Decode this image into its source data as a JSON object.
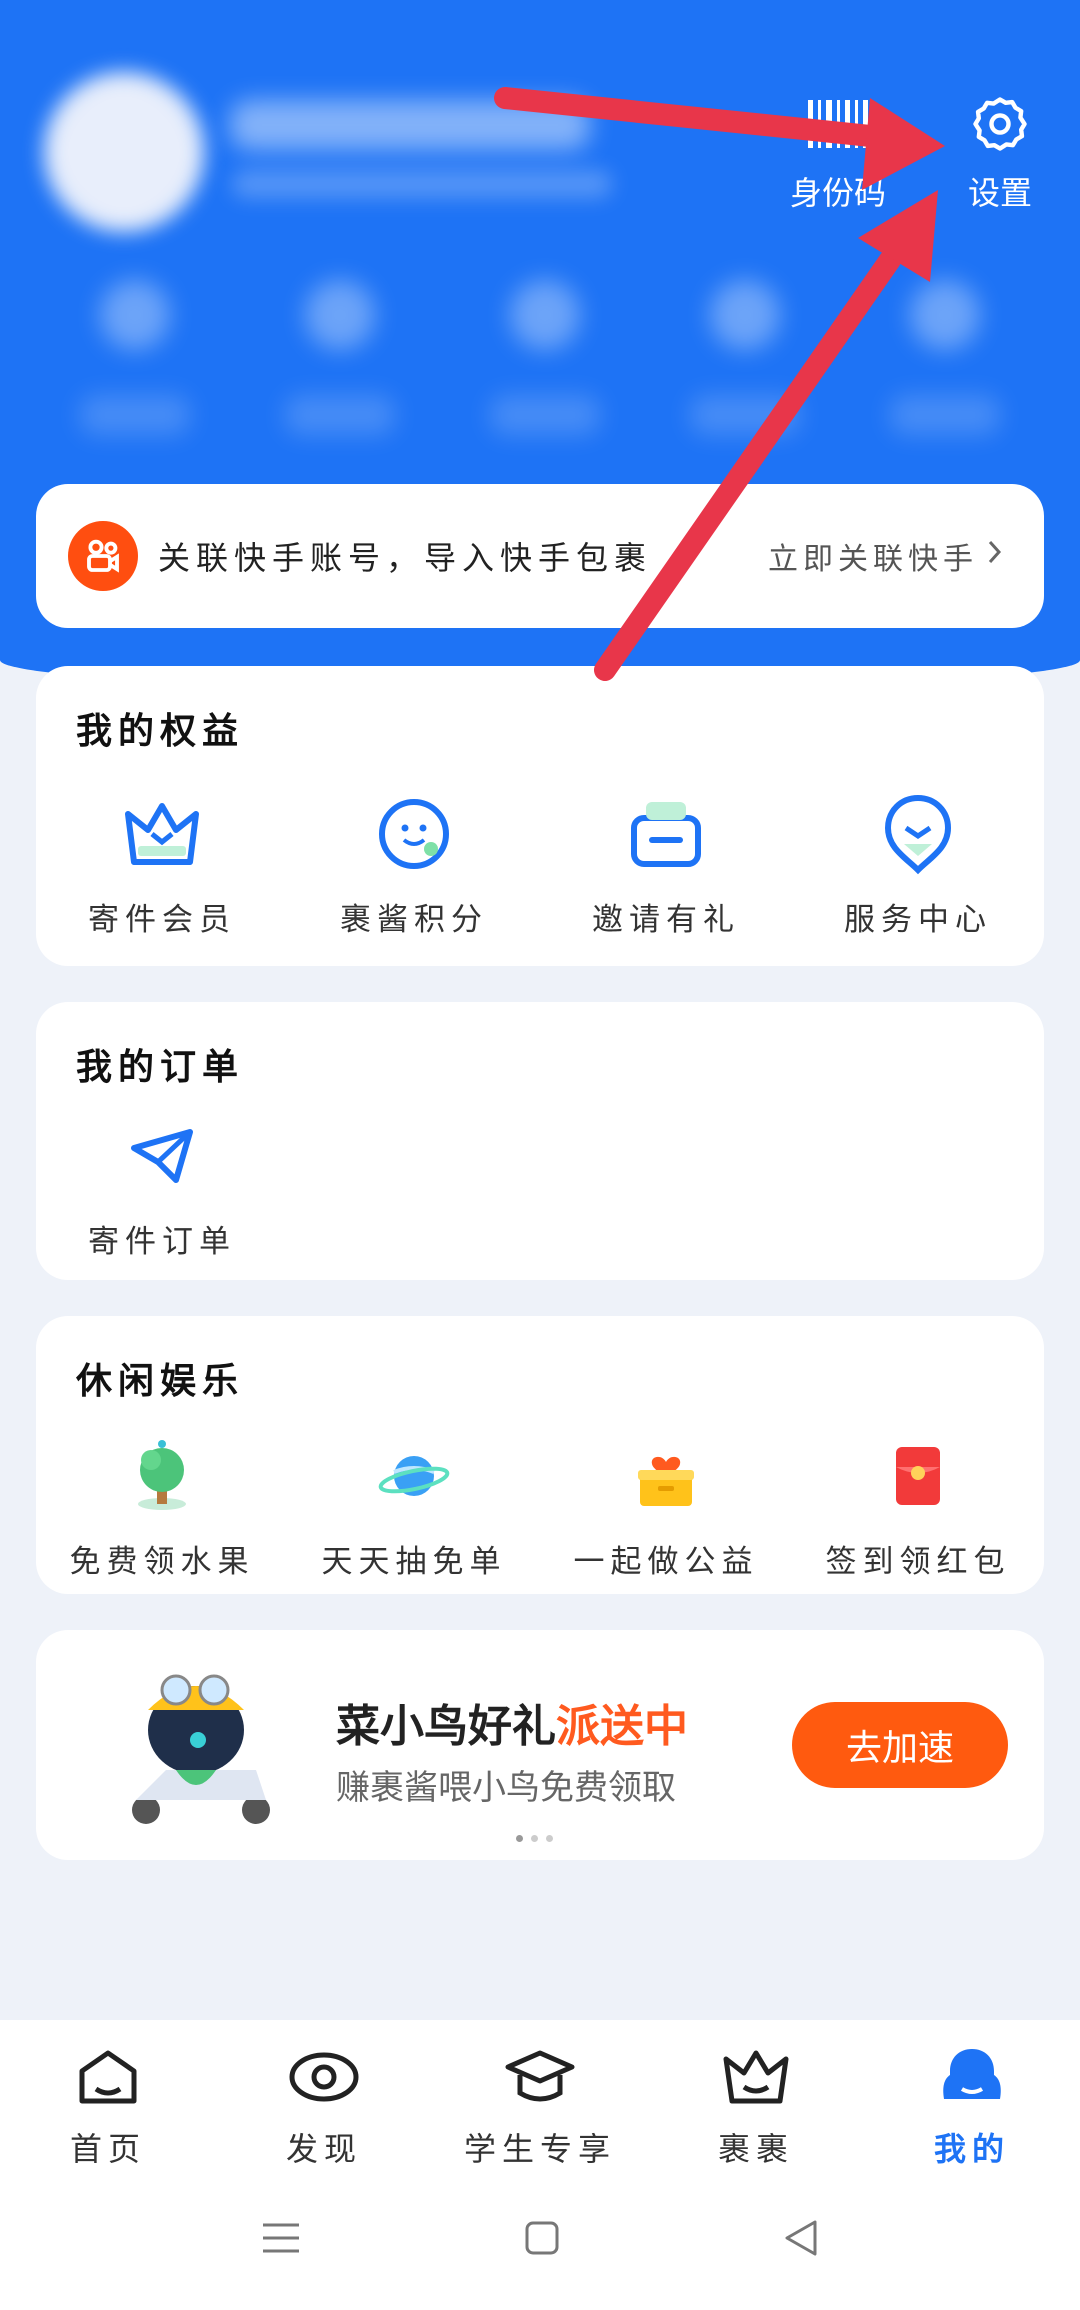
{
  "header": {
    "id_code_label": "身份码",
    "settings_label": "设置"
  },
  "link_banner": {
    "message": "关联快手账号，导入快手包裹",
    "action": "立即关联快手"
  },
  "benefits": {
    "title": "我的权益",
    "items": [
      {
        "label": "寄件会员",
        "icon": "crown-icon"
      },
      {
        "label": "裹酱积分",
        "icon": "mascot-face-icon"
      },
      {
        "label": "邀请有礼",
        "icon": "gift-icon"
      },
      {
        "label": "服务中心",
        "icon": "service-badge-icon"
      }
    ]
  },
  "orders": {
    "title": "我的订单",
    "items": [
      {
        "label": "寄件订单",
        "icon": "paper-plane-icon"
      }
    ]
  },
  "leisure": {
    "title": "休闲娱乐",
    "items": [
      {
        "label": "免费领水果",
        "icon": "fruit-tree-icon"
      },
      {
        "label": "天天抽免单",
        "icon": "planet-icon"
      },
      {
        "label": "一起做公益",
        "icon": "charity-box-icon"
      },
      {
        "label": "签到领红包",
        "icon": "red-envelope-icon"
      }
    ]
  },
  "promo": {
    "title_main": "菜小鸟好礼",
    "title_highlight": "派送中",
    "subtitle": "赚裹酱喂小鸟免费领取",
    "button": "去加速"
  },
  "tabbar": [
    {
      "label": "首页",
      "icon": "home-icon"
    },
    {
      "label": "发现",
      "icon": "eye-icon"
    },
    {
      "label": "学生专享",
      "icon": "graduation-cap-icon"
    },
    {
      "label": "裹裹",
      "icon": "crown-icon"
    },
    {
      "label": "我的",
      "icon": "profile-icon",
      "active": true
    }
  ],
  "colors": {
    "brand_blue": "#1e73f5",
    "accent_orange": "#ff5a0f",
    "annotation_red": "#e8364a",
    "kuaishou_orange": "#ff4e10"
  }
}
